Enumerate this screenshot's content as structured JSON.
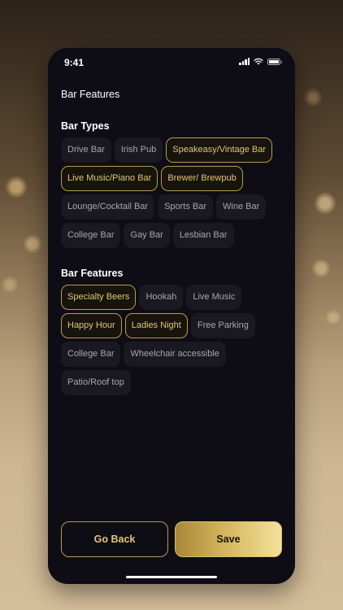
{
  "status_bar": {
    "time": "9:41"
  },
  "header": {
    "title": "Bar Features"
  },
  "bar_types": {
    "title": "Bar Types",
    "chips": [
      {
        "label": "Drive Bar",
        "selected": false
      },
      {
        "label": "Irish Pub",
        "selected": false
      },
      {
        "label": "Speakeasy/Vintage Bar",
        "selected": true
      },
      {
        "label": "Live Music/Piano Bar",
        "selected": true
      },
      {
        "label": "Brewer/ Brewpub",
        "selected": true
      },
      {
        "label": "Lounge/Cocktail Bar",
        "selected": false
      },
      {
        "label": "Sports Bar",
        "selected": false
      },
      {
        "label": "Wine Bar",
        "selected": false
      },
      {
        "label": "College Bar",
        "selected": false
      },
      {
        "label": "Gay Bar",
        "selected": false
      },
      {
        "label": "Lesbian Bar",
        "selected": false
      }
    ]
  },
  "bar_features": {
    "title": "Bar Features",
    "chips": [
      {
        "label": "Specialty Beers",
        "selected": true
      },
      {
        "label": "Hookah",
        "selected": false
      },
      {
        "label": "Live Music",
        "selected": false
      },
      {
        "label": "Happy Hour",
        "selected": true
      },
      {
        "label": "Ladies Night",
        "selected": true
      },
      {
        "label": "Free Parking",
        "selected": false
      },
      {
        "label": "College Bar",
        "selected": false
      },
      {
        "label": "Wheelchair accessible",
        "selected": false
      },
      {
        "label": "Patio/Roof top",
        "selected": false
      }
    ]
  },
  "actions": {
    "back_label": "Go Back",
    "save_label": "Save"
  },
  "colors": {
    "screen_background": "#0e0d16",
    "chip_background": "#1a1922",
    "chip_text": "#a7a6ad",
    "accent_gold": "#e2c574",
    "accent_border": "#b89a4f"
  },
  "icons": [
    "cellular-signal-icon",
    "wifi-icon",
    "battery-icon"
  ]
}
